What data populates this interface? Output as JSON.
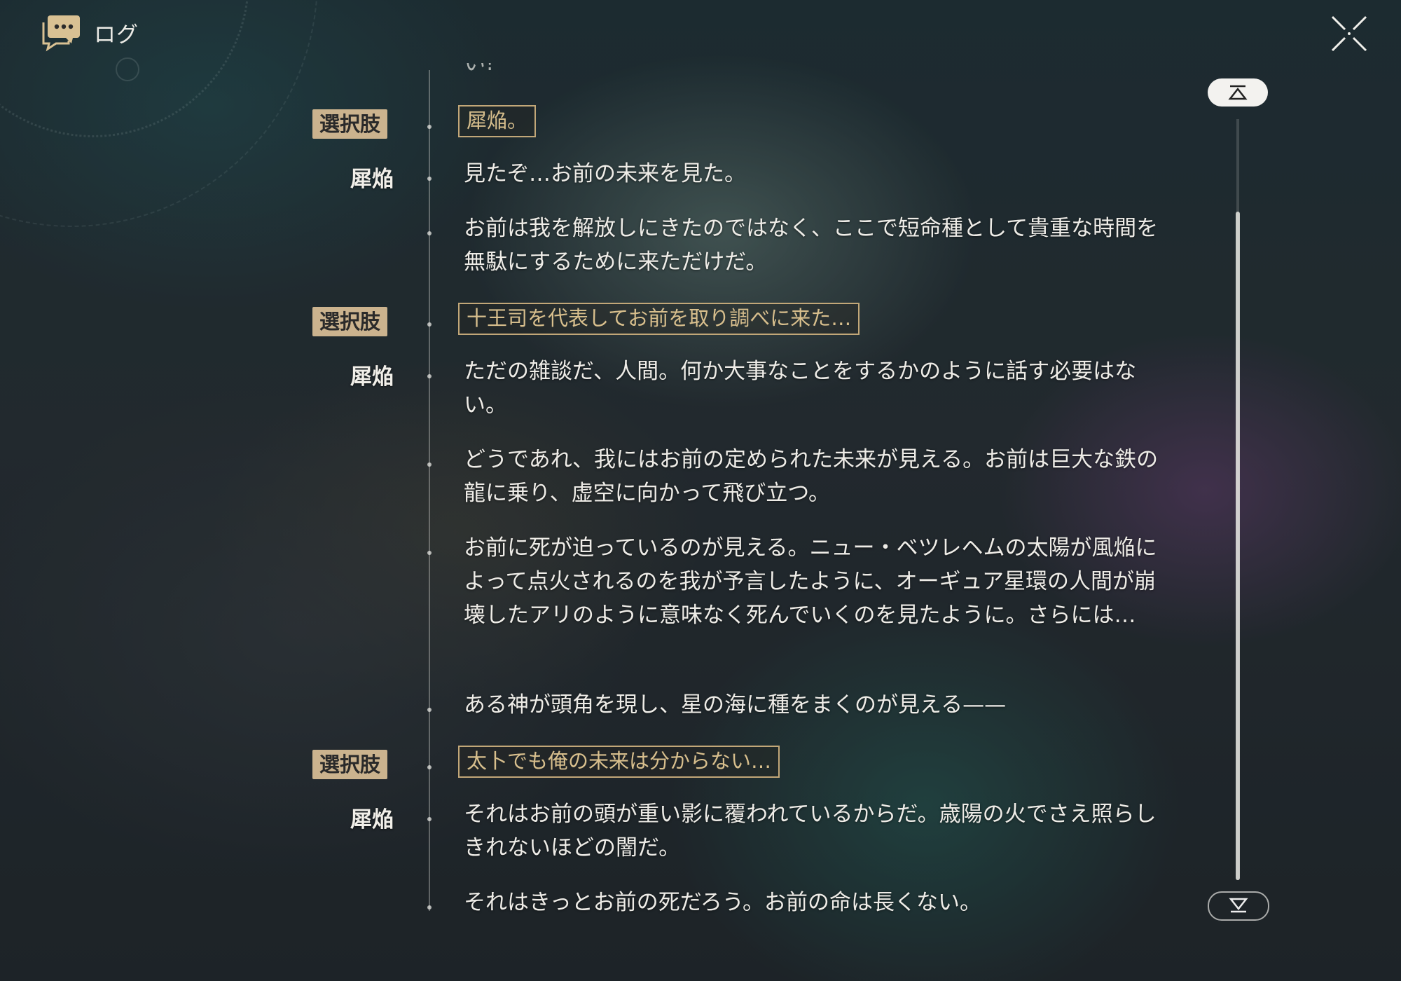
{
  "header": {
    "title": "ログ",
    "icon": "chat-bubble-icon"
  },
  "close_icon": "close-icon",
  "log": {
    "partial_line": "い!",
    "entries": [
      {
        "type": "choice",
        "speaker": "選択肢",
        "text": "犀焔。"
      },
      {
        "type": "line",
        "speaker": "犀焔",
        "text": "見たぞ…お前の未来を見た。"
      },
      {
        "type": "line",
        "speaker": "",
        "text": "お前は我を解放しにきたのではなく、ここで短命種として貴重な時間を無駄にするために来ただけだ。"
      },
      {
        "type": "choice",
        "speaker": "選択肢",
        "text": "十王司を代表してお前を取り調べに来た…"
      },
      {
        "type": "line",
        "speaker": "犀焔",
        "text": "ただの雑談だ、人間。何か大事なことをするかのように話す必要はない。"
      },
      {
        "type": "line",
        "speaker": "",
        "text": "どうであれ、我にはお前の定められた未来が見える。お前は巨大な鉄の龍に乗り、虚空に向かって飛び立つ。"
      },
      {
        "type": "line",
        "speaker": "",
        "text": "お前に死が迫っているのが見える。ニュー・ベツレヘムの太陽が風焔によって点火されるのを我が予言したように、オーギュア星環の人間が崩壊したアリのように意味なく死んでいくのを見たように。さらには…"
      },
      {
        "type": "line",
        "speaker": "",
        "text": "ある神が頭角を現し、星の海に種をまくのが見える——"
      },
      {
        "type": "choice",
        "speaker": "選択肢",
        "text": "太卜でも俺の未来は分からない…"
      },
      {
        "type": "line",
        "speaker": "犀焔",
        "text": "それはお前の頭が重い影に覆われているからだ。歳陽の火でさえ照らしきれないほどの闇だ。"
      },
      {
        "type": "line",
        "speaker": "",
        "text": "それはきっとお前の死だろう。お前の命は長くない。"
      }
    ]
  },
  "scroll": {
    "up_icon": "scroll-top-icon",
    "down_icon": "scroll-bottom-icon",
    "position": 0.12
  },
  "colors": {
    "accent": "#cbb38e",
    "choice_text": "#d8bf8d"
  }
}
